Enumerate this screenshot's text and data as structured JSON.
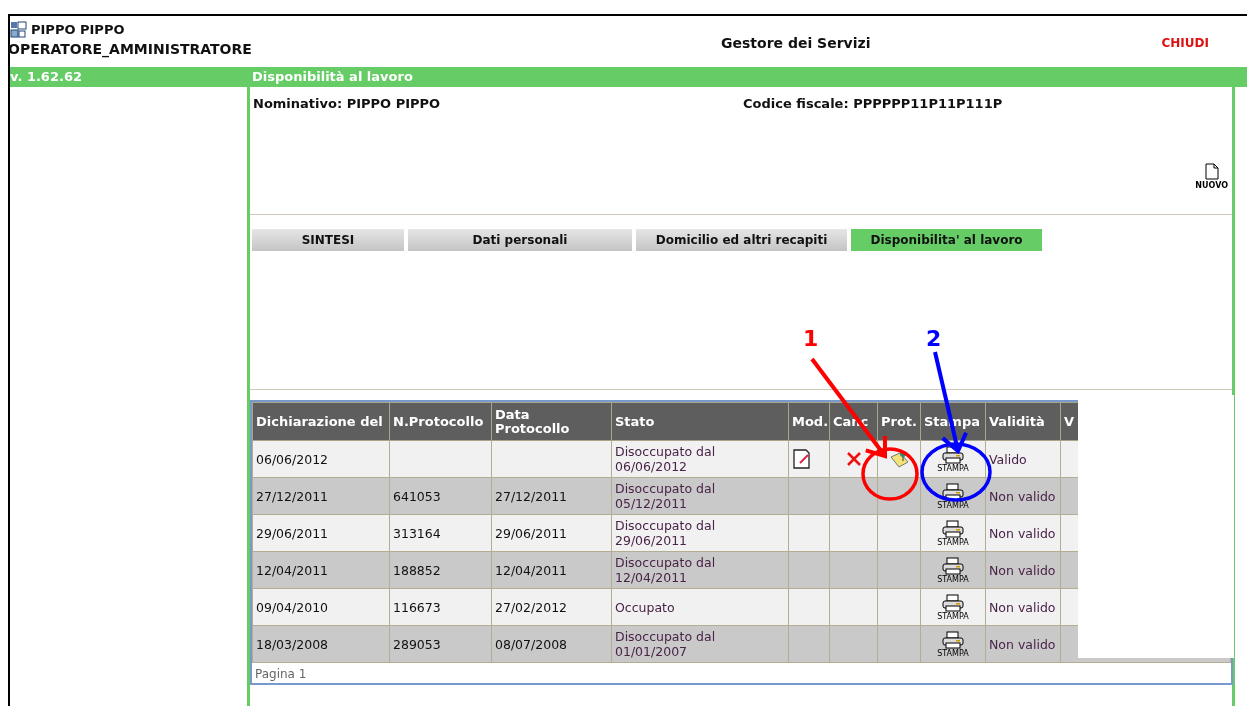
{
  "header": {
    "user": "PIPPO PIPPO",
    "role": "OPERATORE_AMMINISTRATORE",
    "title": "Gestore dei Servizi",
    "close": "CHIUDI"
  },
  "green_bar": {
    "version": "v. 1.62.62",
    "section": "Disponibilità al lavoro"
  },
  "person": {
    "name_label": "Nominativo:",
    "name": "PIPPO PIPPO",
    "tax_label": "Codice fiscale:",
    "tax_code": "PPPPPP11P11P111P",
    "new_button": "NUOVO"
  },
  "tabs": [
    {
      "label": "SINTESI",
      "selected": false
    },
    {
      "label": "Dati personali",
      "selected": false
    },
    {
      "label": "Domicilio ed altri recapiti",
      "selected": false
    },
    {
      "label": "Disponibilita' al lavoro",
      "selected": true
    }
  ],
  "table": {
    "columns": [
      "Dichiarazione del",
      "N.Protocollo",
      "Data Protocollo",
      "Stato",
      "Mod.",
      "Canc",
      "Prot.",
      "Stampa",
      "Validità",
      "V"
    ],
    "rows": [
      {
        "date": "06/06/2012",
        "protocol": "",
        "protocol_date": "",
        "status": "Disoccupato dal 06/06/2012",
        "editable": true,
        "deletable": true,
        "protocollable": true,
        "print": "STAMPA",
        "validity": "Valido"
      },
      {
        "date": "27/12/2011",
        "protocol": "641053",
        "protocol_date": "27/12/2011",
        "status": "Disoccupato dal 05/12/2011",
        "editable": false,
        "deletable": false,
        "protocollable": false,
        "print": "STAMPA",
        "validity": "Non valido"
      },
      {
        "date": "29/06/2011",
        "protocol": "313164",
        "protocol_date": "29/06/2011",
        "status": "Disoccupato dal 29/06/2011",
        "editable": false,
        "deletable": false,
        "protocollable": false,
        "print": "STAMPA",
        "validity": "Non valido"
      },
      {
        "date": "12/04/2011",
        "protocol": "188852",
        "protocol_date": "12/04/2011",
        "status": "Disoccupato dal 12/04/2011",
        "editable": false,
        "deletable": false,
        "protocollable": false,
        "print": "STAMPA",
        "validity": "Non valido"
      },
      {
        "date": "09/04/2010",
        "protocol": "116673",
        "protocol_date": "27/02/2012",
        "status": "Occupato",
        "editable": false,
        "deletable": false,
        "protocollable": false,
        "print": "STAMPA",
        "validity": "Non valido"
      },
      {
        "date": "18/03/2008",
        "protocol": "289053",
        "protocol_date": "08/07/2008",
        "status": "Disoccupato dal 01/01/2007",
        "editable": false,
        "deletable": false,
        "protocollable": false,
        "print": "STAMPA",
        "validity": "Non valido"
      }
    ],
    "pager": "Pagina 1"
  },
  "annotations": [
    {
      "label": "1",
      "color": "#ff0000"
    },
    {
      "label": "2",
      "color": "#0000ff"
    }
  ]
}
